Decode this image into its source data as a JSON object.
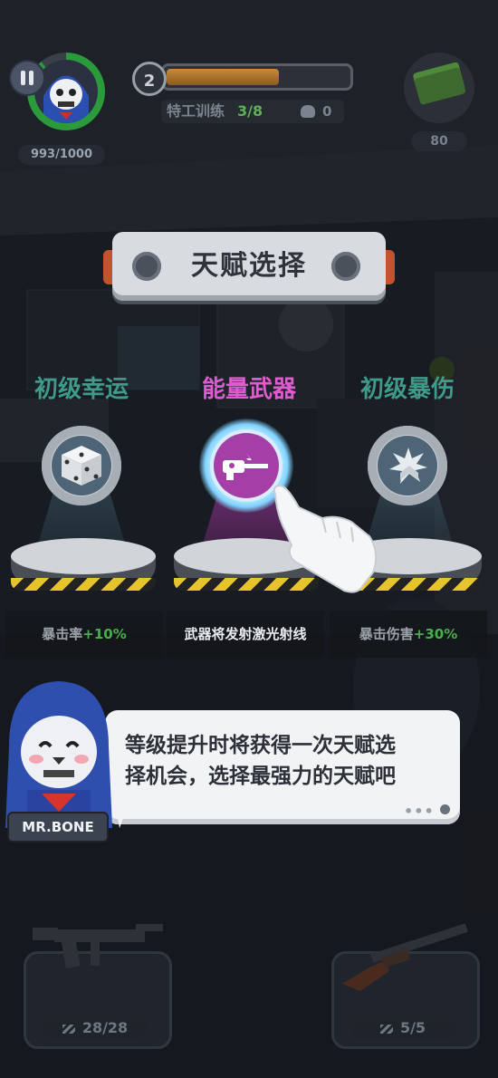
{
  "hud": {
    "hp": "993/1000",
    "level": "2",
    "xp_progress": 0.6,
    "task_label": "特工训练",
    "task_progress": "3/8",
    "kill_count": "0",
    "cash": "80"
  },
  "talent_panel": {
    "title": "天赋选择"
  },
  "talents": [
    {
      "name": "初级幸运",
      "icon": "dice-icon",
      "desc_label": "暴击率",
      "desc_value": "+10%"
    },
    {
      "name": "能量武器",
      "icon": "laser-gun-icon",
      "desc_text": "武器将发射激光射线"
    },
    {
      "name": "初级暴伤",
      "icon": "explosion-icon",
      "desc_label": "暴击伤害",
      "desc_value": "+30%"
    }
  ],
  "dialog": {
    "speaker": "MR.BONE",
    "line1": "等级提升时将获得一次天赋选",
    "line2": "择机会，选择最强力的天赋吧",
    "more": "•••"
  },
  "weapons": [
    {
      "icon": "smg-icon",
      "ammo": "28/28"
    },
    {
      "icon": "shotgun-icon",
      "ammo": "5/5"
    }
  ],
  "colors": {
    "talent_common": "#3f9a8a",
    "talent_selected": "#e05bd0",
    "bonus_green": "#46b04a",
    "hp_ring": "#2a9a3a"
  }
}
